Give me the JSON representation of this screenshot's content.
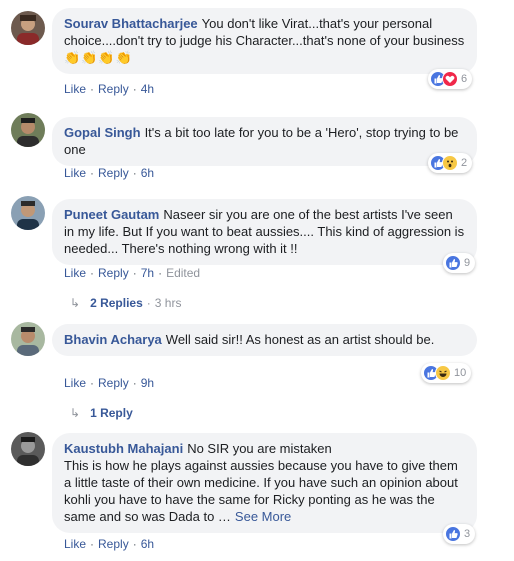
{
  "comments": [
    {
      "author": "Sourav Bhattacharjee",
      "text": "You don't like Virat...that's your personal choice....don't try to judge his Character...that's none of your business",
      "emoji": "👏👏👏👏",
      "like": "Like",
      "reply": "Reply",
      "time": "4h",
      "reaction_count": "6",
      "reactions": [
        "like",
        "love"
      ]
    },
    {
      "author": "Gopal Singh",
      "text": "It's a bit too late for you to be a 'Hero', stop trying to be one",
      "like": "Like",
      "reply": "Reply",
      "time": "6h",
      "reaction_count": "2",
      "reactions": [
        "like",
        "wow"
      ]
    },
    {
      "author": "Puneet Gautam",
      "text": "Naseer sir you are one of the best artists I've seen in my life. But If you want to beat aussies.... This kind of aggression is needed... There's nothing wrong with it !!",
      "like": "Like",
      "reply": "Reply",
      "time": "7h",
      "edited": "Edited",
      "reaction_count": "9",
      "reactions": [
        "like"
      ],
      "replies_label": "2 Replies",
      "replies_age": "3 hrs"
    },
    {
      "author": "Bhavin Acharya",
      "text": "Well said sir!! As honest as an artist should be.",
      "like": "Like",
      "reply": "Reply",
      "time": "9h",
      "reaction_count": "10",
      "reactions": [
        "like",
        "haha"
      ],
      "replies_label": "1 Reply"
    },
    {
      "author": "Kaustubh Mahajani",
      "text": "No SIR you are mistaken\nThis is how he plays against aussies because you have to give them a little taste of their own medicine. If you have such an opinion about kohli you have to have the same for Ricky ponting as he was the same and so was Dada to …",
      "see_more": "See More",
      "like": "Like",
      "reply": "Reply",
      "time": "6h",
      "reaction_count": "3",
      "reactions": [
        "like"
      ]
    }
  ],
  "colors": {
    "author": "#385898",
    "bubble": "#f2f3f5",
    "meta": "#606770",
    "like_reaction": "#4a76e0",
    "love_reaction": "#f0284a",
    "wow_reaction": "#f7c845"
  }
}
